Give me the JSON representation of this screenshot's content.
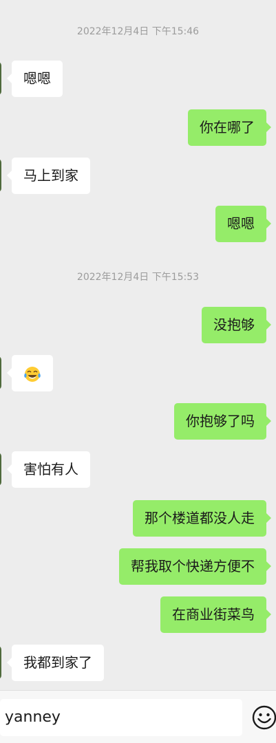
{
  "messages": [
    {
      "type": "time",
      "text": "2022年12月4日 下午15:46"
    },
    {
      "type": "in",
      "text": "嗯嗯"
    },
    {
      "type": "out",
      "text": "你在哪了"
    },
    {
      "type": "in",
      "text": "马上到家"
    },
    {
      "type": "out",
      "text": "嗯嗯"
    },
    {
      "type": "time",
      "text": "2022年12月4日 下午15:53"
    },
    {
      "type": "out",
      "text": "没抱够"
    },
    {
      "type": "in",
      "emoji": "tears-of-joy-emoji"
    },
    {
      "type": "out",
      "text": "你抱够了吗"
    },
    {
      "type": "in",
      "text": "害怕有人"
    },
    {
      "type": "out",
      "text": "那个楼道都没人走"
    },
    {
      "type": "out",
      "text": "帮我取个快递方便不"
    },
    {
      "type": "out",
      "text": "在商业街菜鸟"
    },
    {
      "type": "in",
      "text": "我都到家了"
    }
  ],
  "input": {
    "value": "yanney"
  },
  "icons": {
    "emoji_button": "smiley-icon"
  },
  "colors": {
    "outgoing": "#95ec69",
    "incoming": "#ffffff",
    "background": "#ededed"
  }
}
